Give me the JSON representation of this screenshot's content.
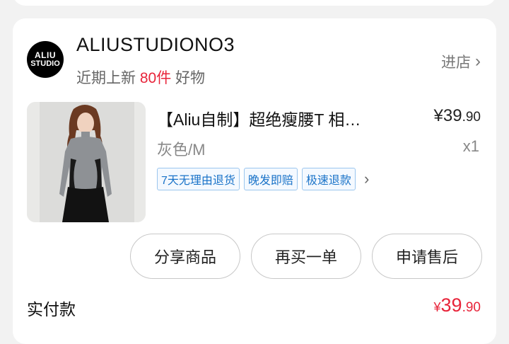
{
  "store": {
    "logo_line1": "ALIU",
    "logo_line2": "STUDIO",
    "name": "ALIUSTUDIONO3",
    "sub_prefix": "近期上新",
    "sub_highlight": "80件",
    "sub_suffix": "好物",
    "enter_label": "进店"
  },
  "product": {
    "title": "【Aliu自制】超绝瘦腰T 相…",
    "price_symbol": "¥",
    "price_int": "39",
    "price_dec": ".90",
    "spec": "灰色/M",
    "quantity": "x1",
    "tags": [
      "7天无理由退货",
      "晚发即赔",
      "极速退款"
    ]
  },
  "actions": {
    "share": "分享商品",
    "rebuy": "再买一单",
    "after_sale": "申请售后"
  },
  "payment": {
    "label": "实付款",
    "symbol": "¥",
    "amount_int": "39",
    "amount_dec": ".90"
  },
  "colors": {
    "accent_red": "#e8243a",
    "tag_blue": "#1a73c8"
  }
}
